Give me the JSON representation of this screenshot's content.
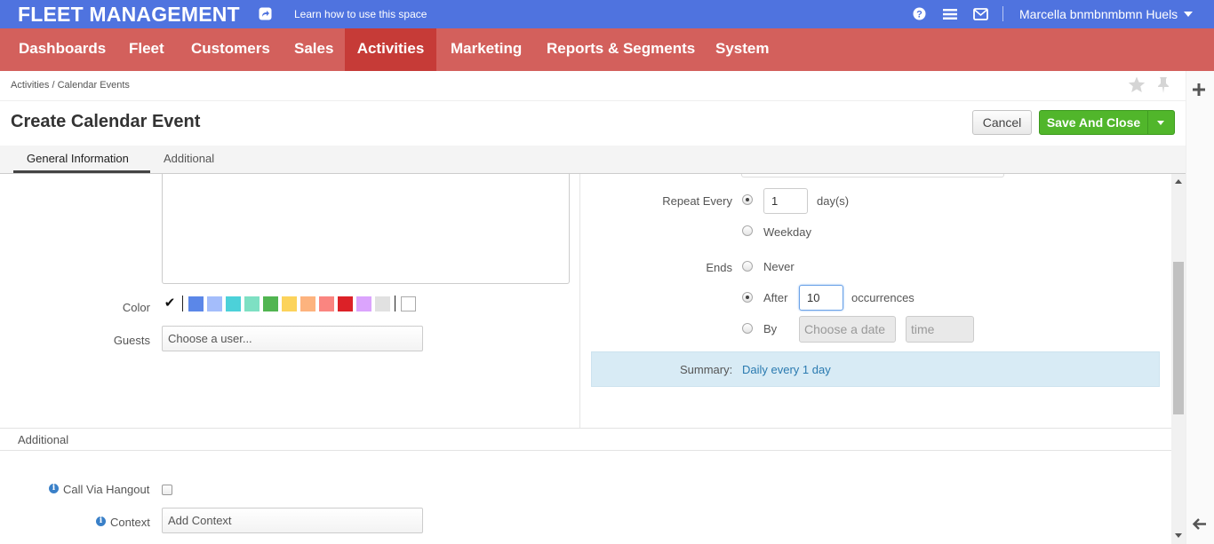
{
  "topbar": {
    "app_title": "FLEET MANAGEMENT",
    "learn_link": "Learn how to use this space",
    "user_name": "Marcella bnmbnmbmn Huels"
  },
  "nav": {
    "items": [
      {
        "label": "Dashboards"
      },
      {
        "label": "Fleet"
      },
      {
        "label": "Customers"
      },
      {
        "label": "Sales"
      },
      {
        "label": "Activities",
        "active": true
      },
      {
        "label": "Marketing"
      },
      {
        "label": "Reports & Segments"
      },
      {
        "label": "System"
      }
    ]
  },
  "breadcrumb": "Activities / Calendar Events",
  "page": {
    "title": "Create Calendar Event",
    "cancel_label": "Cancel",
    "save_label": "Save And Close"
  },
  "tabs": [
    {
      "label": "General Information",
      "active": true
    },
    {
      "label": "Additional"
    }
  ],
  "form": {
    "color_label": "Color",
    "colors": [
      "#5b87e8",
      "#a4bdfb",
      "#4cd1d9",
      "#7ee0c3",
      "#51b551",
      "#fcd35b",
      "#fdb37e",
      "#fa8580",
      "#dc2127",
      "#dba4fd",
      "#e1e1e1"
    ],
    "guests_label": "Guests",
    "guests_placeholder": "Choose a user...",
    "repeat_every_label": "Repeat Every",
    "repeat_every_value": "1",
    "repeat_unit": "day(s)",
    "weekday_label": "Weekday",
    "ends_label": "Ends",
    "never_label": "Never",
    "after_label": "After",
    "after_value": "10",
    "occurrences_label": "occurrences",
    "by_label": "By",
    "date_placeholder": "Choose a date",
    "time_placeholder": "time",
    "summary_label": "Summary:",
    "summary_value": "Daily every 1 day"
  },
  "additional": {
    "section_title": "Additional",
    "call_via_hangout_label": "Call Via Hangout",
    "context_label": "Context",
    "context_placeholder": "Add Context"
  }
}
